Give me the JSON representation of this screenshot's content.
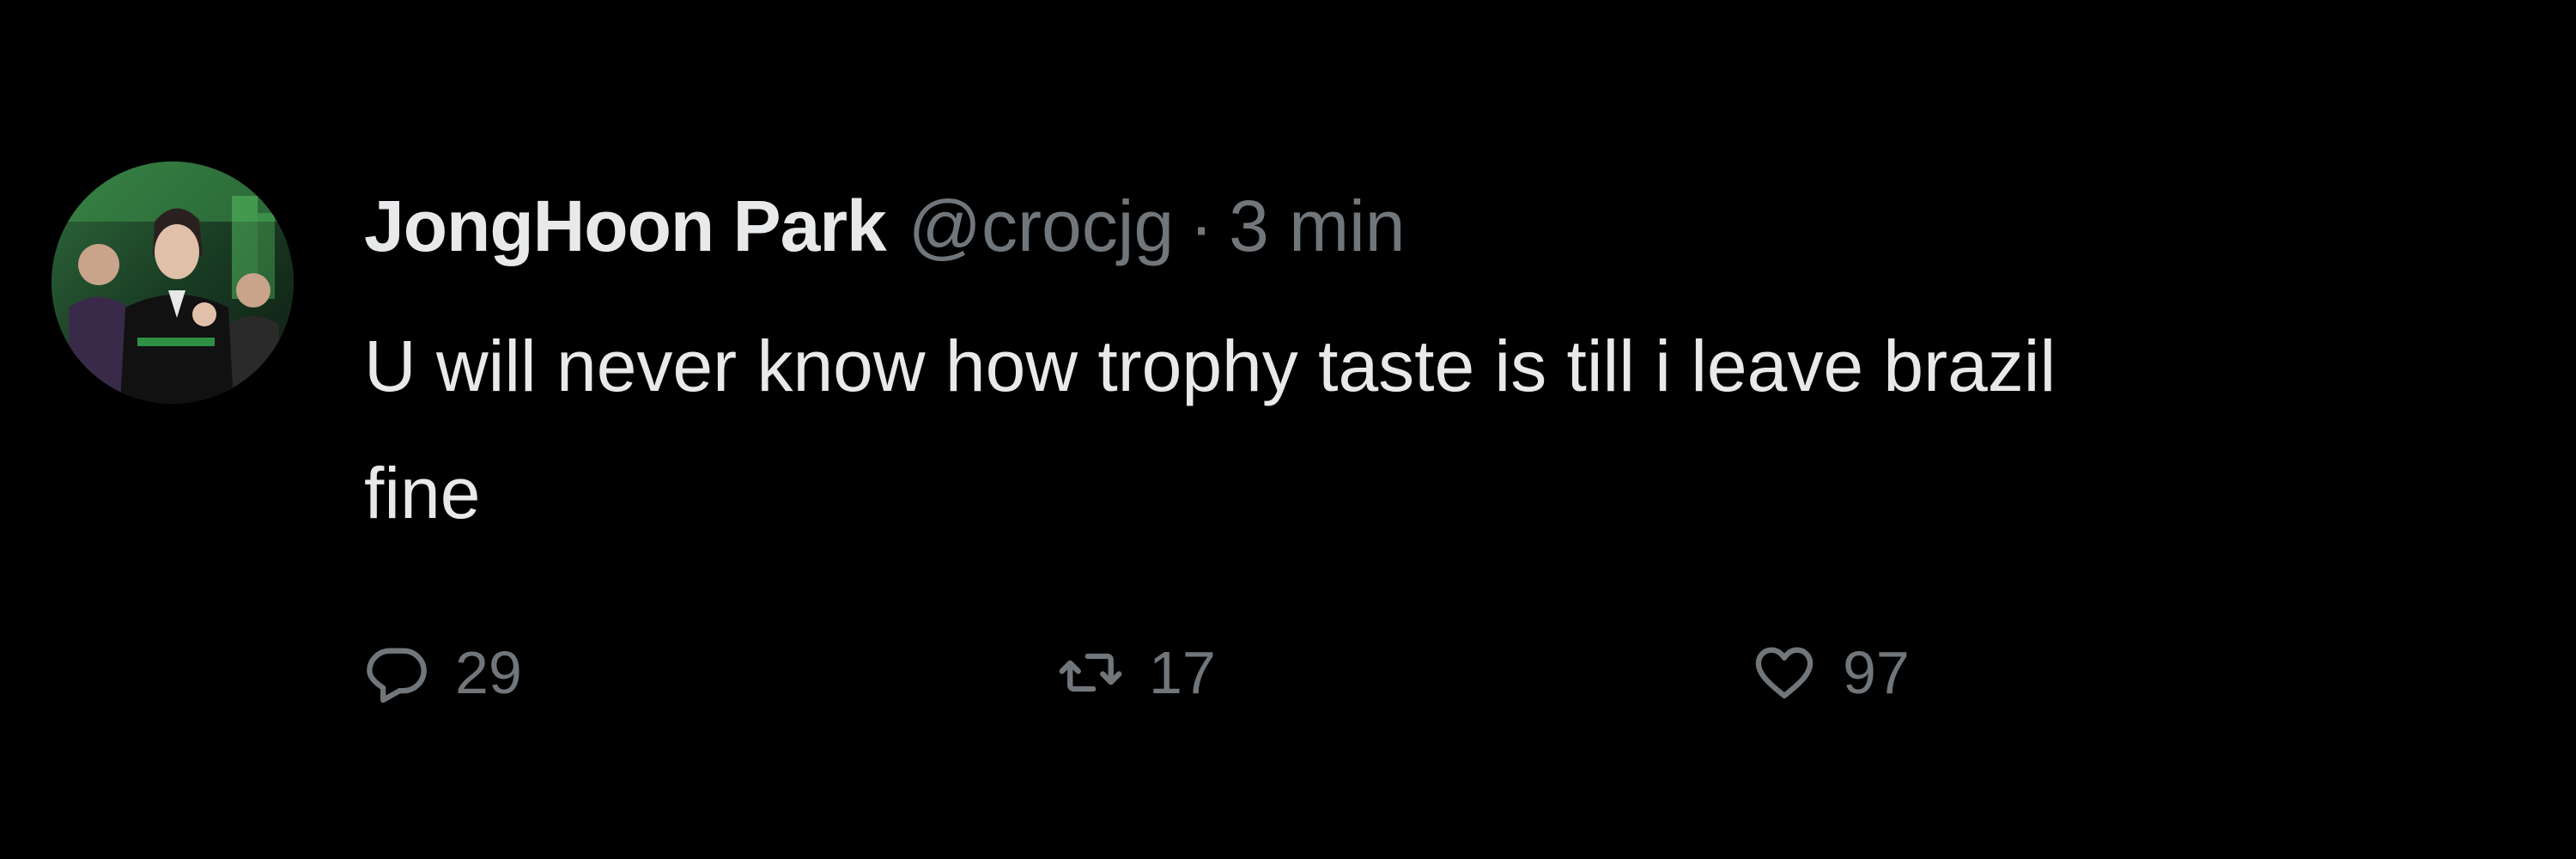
{
  "tweet": {
    "author": {
      "display_name": "JongHoon Park",
      "handle": "@crocjg"
    },
    "separator": "·",
    "timestamp": "3 min",
    "text_line_1": "U will never know how trophy taste is till i leave brazil",
    "text_line_2": "fine",
    "actions": {
      "reply": {
        "icon": "reply-icon",
        "count": "29"
      },
      "retweet": {
        "icon": "retweet-icon",
        "count": "17"
      },
      "like": {
        "icon": "heart-icon",
        "count": "97"
      }
    }
  },
  "colors": {
    "background": "#000000",
    "primary_text": "#e7e9ea",
    "secondary_text": "#71767b"
  }
}
